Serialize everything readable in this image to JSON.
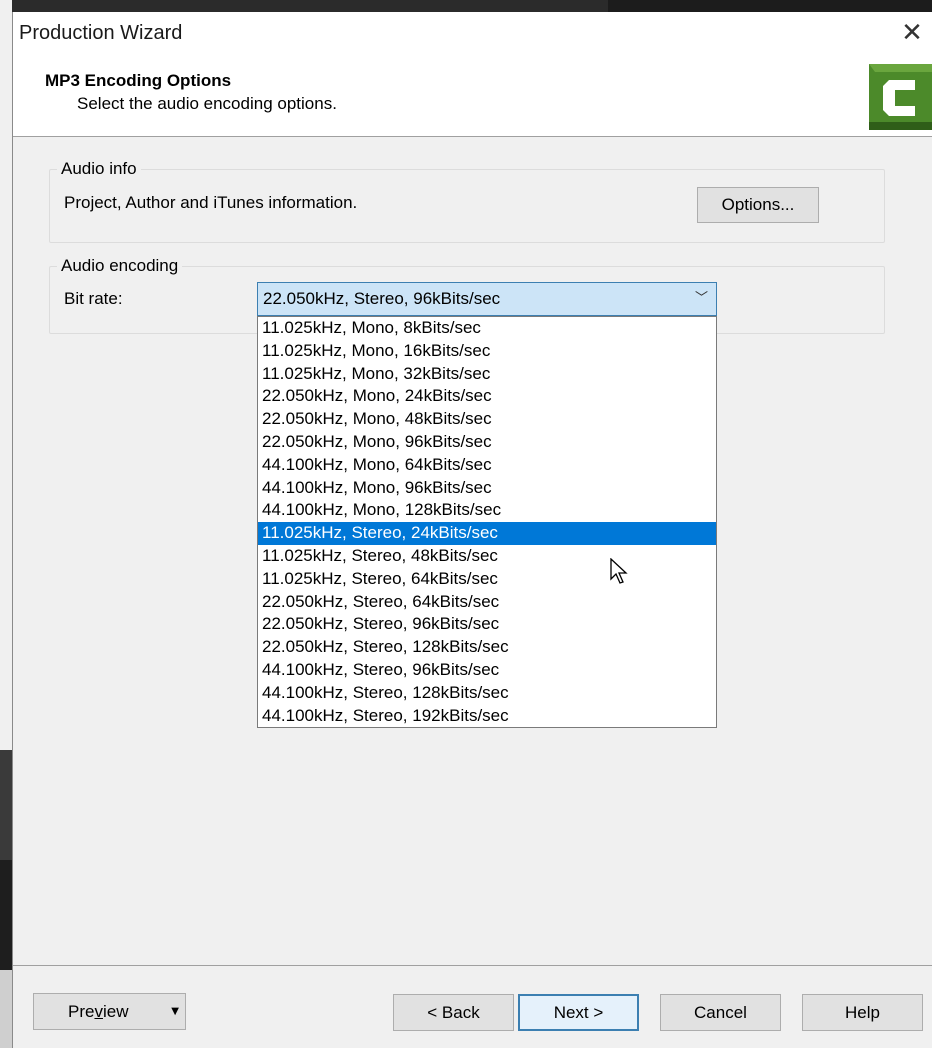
{
  "window": {
    "title": "Production Wizard"
  },
  "header": {
    "heading": "MP3 Encoding Options",
    "subheading": "Select the audio encoding options."
  },
  "audio_info": {
    "group_label": "Audio info",
    "description": "Project, Author and iTunes information.",
    "options_button": "Options..."
  },
  "audio_encoding": {
    "group_label": "Audio encoding",
    "bitrate_label": "Bit rate:",
    "selected_value": "22.050kHz, Stereo, 96kBits/sec",
    "highlighted_index": 9,
    "options": [
      "11.025kHz, Mono, 8kBits/sec",
      "11.025kHz, Mono, 16kBits/sec",
      "11.025kHz, Mono, 32kBits/sec",
      "22.050kHz, Mono, 24kBits/sec",
      "22.050kHz, Mono, 48kBits/sec",
      "22.050kHz, Mono, 96kBits/sec",
      "44.100kHz, Mono, 64kBits/sec",
      "44.100kHz, Mono, 96kBits/sec",
      "44.100kHz, Mono, 128kBits/sec",
      "11.025kHz, Stereo, 24kBits/sec",
      "11.025kHz, Stereo, 48kBits/sec",
      "11.025kHz, Stereo, 64kBits/sec",
      "22.050kHz, Stereo, 64kBits/sec",
      "22.050kHz, Stereo, 96kBits/sec",
      "22.050kHz, Stereo, 128kBits/sec",
      "44.100kHz, Stereo, 96kBits/sec",
      "44.100kHz, Stereo, 128kBits/sec",
      "44.100kHz, Stereo, 192kBits/sec"
    ]
  },
  "footer": {
    "preview_pre": "Pre",
    "preview_underlined": "v",
    "preview_post": "iew",
    "back_button": "< Back",
    "next_button": "Next >",
    "cancel_button": "Cancel",
    "help_button": "Help"
  },
  "colors": {
    "selection": "#0078d7",
    "combo_focus": "#cce4f7",
    "logo_green": "#4c8a2a"
  },
  "icons": {
    "close": "close-icon",
    "logo": "camtasia-logo-icon",
    "dropdown": "chevron-down-icon",
    "cursor": "mouse-pointer-icon"
  }
}
